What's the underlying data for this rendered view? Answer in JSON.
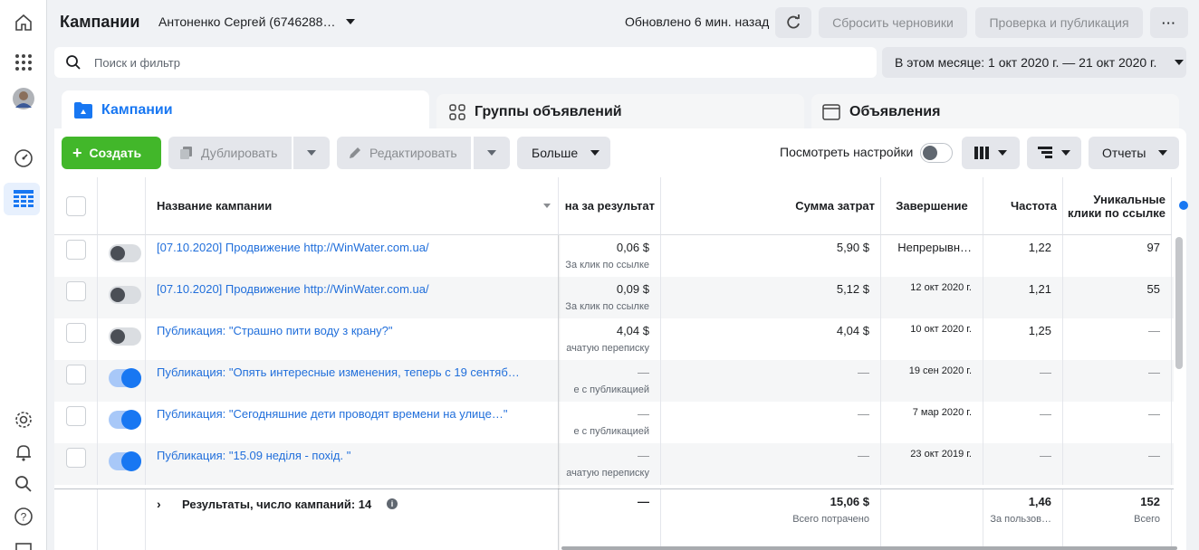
{
  "header": {
    "title": "Кампании",
    "account": "Антоненко Сергей (6746288…",
    "updated": "Обновлено 6 мин. назад",
    "discard_drafts": "Сбросить черновики",
    "review_publish": "Проверка и публикация",
    "more": "···"
  },
  "search": {
    "placeholder": "Поиск и фильтр"
  },
  "date_range": "В этом месяце: 1 окт 2020 г. — 21 окт 2020 г.",
  "level_tabs": [
    {
      "label": "Кампании"
    },
    {
      "label": "Группы объявлений"
    },
    {
      "label": "Объявления"
    }
  ],
  "toolbar": {
    "create": "Создать",
    "duplicate": "Дублировать",
    "edit": "Редактировать",
    "more": "Больше",
    "view_setup": "Посмотреть настройки",
    "reports": "Отчеты"
  },
  "columns": {
    "name": "Название кампании",
    "cost_per_result": "на за результат",
    "amount_spent": "Сумма затрат",
    "ends": "Завершение",
    "frequency": "Частота",
    "unique_clicks": "Уникальные клики по ссылке"
  },
  "rows": [
    {
      "name": "[07.10.2020] Продвижение http://WinWater.com.ua/",
      "cpr": "0,06 $",
      "cpr_sub": "За клик по ссылке",
      "spent": "5,90 $",
      "ends": "Непрерывн…",
      "freq": "1,22",
      "uclicks": "97"
    },
    {
      "name": "[07.10.2020] Продвижение http://WinWater.com.ua/",
      "cpr": "0,09 $",
      "cpr_sub": "За клик по ссылке",
      "spent": "5,12 $",
      "ends": "12 окт 2020 г.",
      "freq": "1,21",
      "uclicks": "55"
    },
    {
      "name": "Публикация: \"Страшно пити воду з крану?\"",
      "cpr": "4,04 $",
      "cpr_sub": "ачатую переписку",
      "spent": "4,04 $",
      "ends": "10 окт 2020 г.",
      "freq": "1,25",
      "uclicks": "—"
    },
    {
      "name": "Публикация: \"Опять интересные изменения, теперь с 19 сентяб…",
      "cpr": "—",
      "cpr_sub": "е с публикацией",
      "spent": "—",
      "ends": "19 сен 2020 г.",
      "freq": "—",
      "uclicks": "—"
    },
    {
      "name": "Публикация: \"Сегодняшние дети проводят времени на улице…\"",
      "cpr": "—",
      "cpr_sub": "е с публикацией",
      "spent": "—",
      "ends": "7 мар 2020 г.",
      "freq": "—",
      "uclicks": "—"
    },
    {
      "name": "Публикация: \"15.09 неділя - похід. \"",
      "cpr": "—",
      "cpr_sub": "ачатую переписку",
      "spent": "—",
      "ends": "23 окт 2019 г.",
      "freq": "—",
      "uclicks": "—"
    }
  ],
  "row_states": [
    "off",
    "off",
    "off",
    "on",
    "on",
    "on"
  ],
  "totals": {
    "label": "Результаты, число кампаний: 14",
    "cpr": "—",
    "spent": "15,06 $",
    "spent_sub": "Всего потрачено",
    "freq": "1,46",
    "freq_sub": "За пользов…",
    "uclicks": "152",
    "uclicks_sub": "Всего"
  }
}
